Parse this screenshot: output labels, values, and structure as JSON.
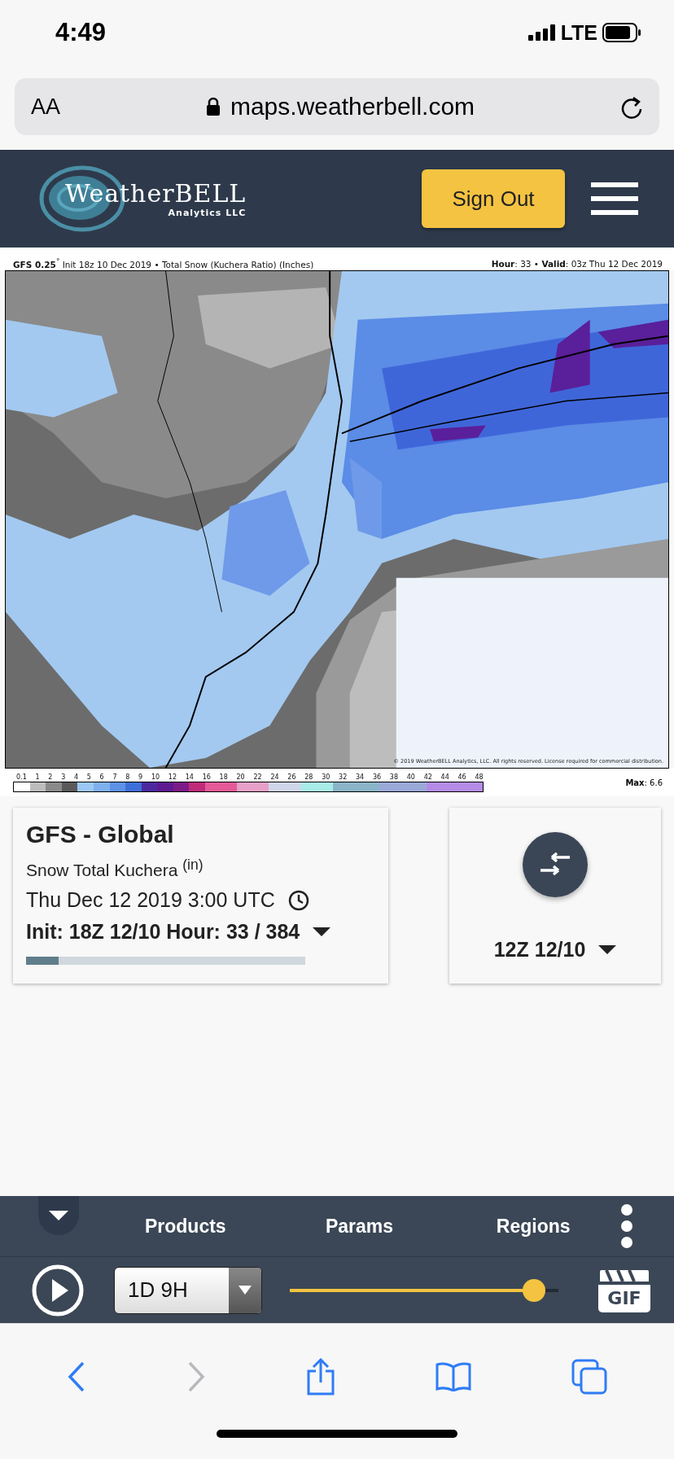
{
  "status_bar": {
    "time": "4:49",
    "network": "LTE"
  },
  "browser": {
    "text_size": "AA",
    "url": "maps.weatherbell.com"
  },
  "header": {
    "logo_main": "WeatherBELL",
    "logo_sub": "Analytics LLC",
    "sign_out": "Sign Out"
  },
  "map": {
    "title_left": "**GFS 0.25**$^{°}$ Init 18z 10 Dec 2019 • Total Snow (Kuchera Ratio) (Inches)",
    "title_right": "**Hour**: 33 • **Valid**: 03z Thu 12 Dec 2019",
    "copyright": "© 2019 WeatherBELL Analytics, LLC. All rights reserved. License required for commercial distribution.",
    "max": "**Max**: 6.6",
    "legend_ticks": [
      "0.1",
      "1",
      "2",
      "3",
      "4",
      "5",
      "6",
      "7",
      "8",
      "9",
      "10",
      "12",
      "14",
      "16",
      "18",
      "20",
      "22",
      "24",
      "26",
      "28",
      "30",
      "32",
      "34",
      "36",
      "38",
      "40",
      "42",
      "44",
      "46",
      "48"
    ]
  },
  "model_card": {
    "title": "GFS - Global",
    "param": "Snow Total Kuchera $^{(in)}$",
    "valid": "Thu Dec 12 2019 3:00 UTC",
    "run": "Init: 18Z 12/10  Hour: 33 / 384",
    "level": 0.117
  },
  "compare_card": {
    "run": "12Z 12/10"
  },
  "bottom_bar": {
    "menu": [
      "Products",
      "Params",
      "Regions"
    ],
    "speed": "1D 9H",
    "level": 0.91,
    "gif": "GIF"
  },
  "toolbar": {
    "back_disabled": false,
    "forward_disabled": true
  }
}
